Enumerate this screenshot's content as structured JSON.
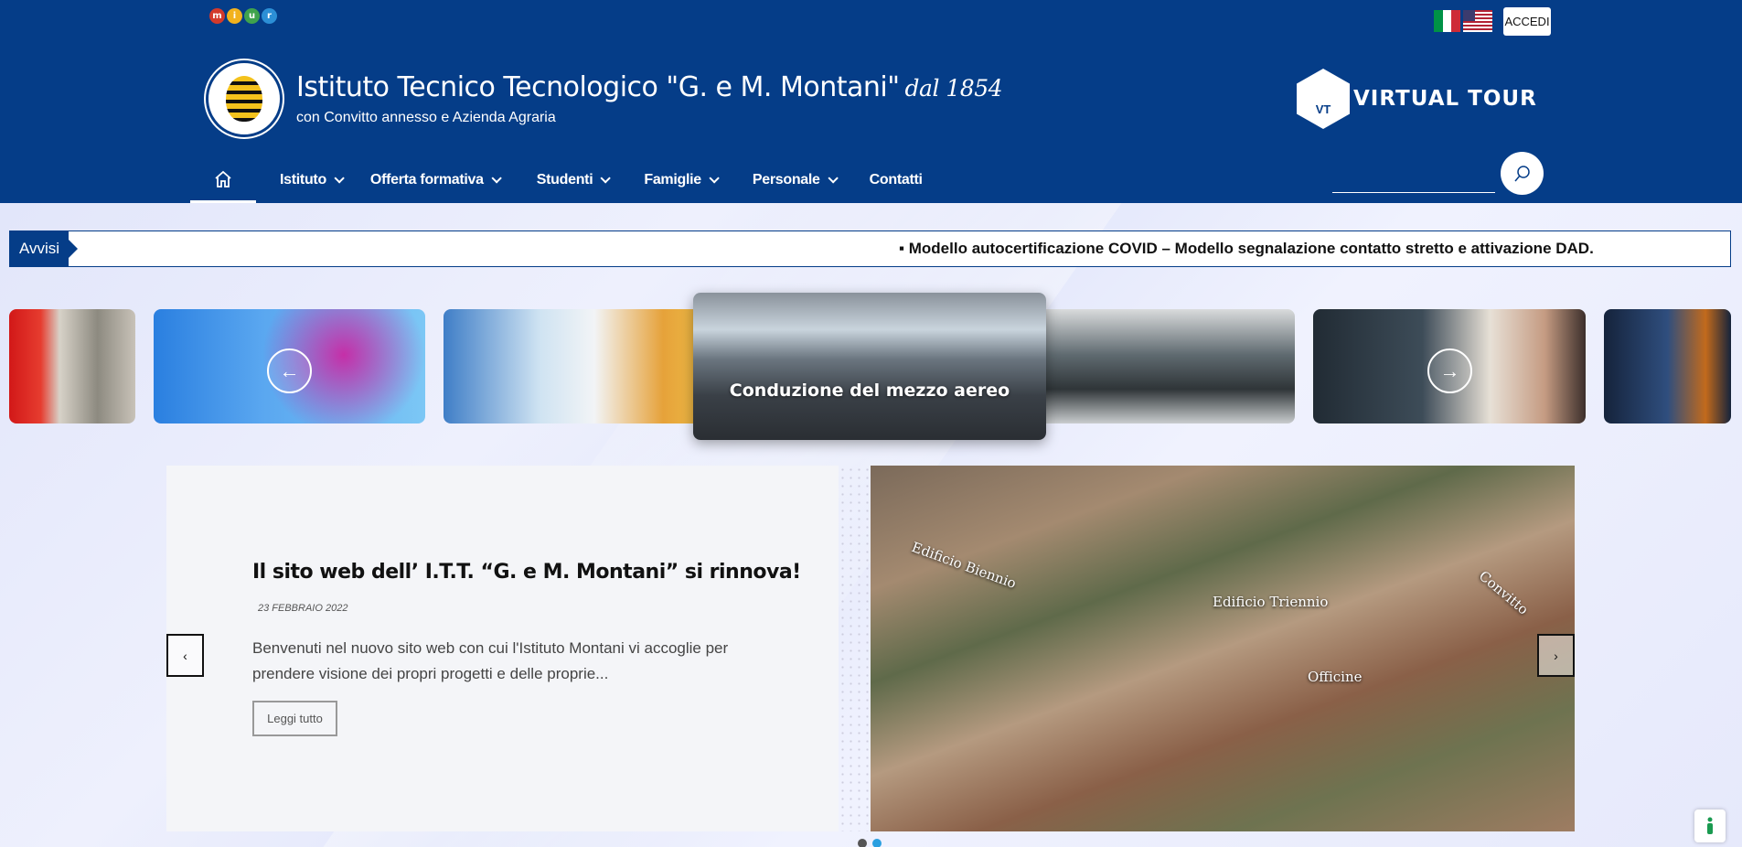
{
  "top_bar": {
    "miur_letters": [
      "m",
      "i",
      "u",
      "r"
    ],
    "miur_colors": [
      "#d33a2c",
      "#f2b21d",
      "#3fa34d",
      "#2c8fd6"
    ],
    "login_label": "ACCEDI"
  },
  "branding": {
    "title": "Istituto Tecnico Tecnologico \"G. e M. Montani\"",
    "since": "dal 1854",
    "subtitle": "con Convitto annesso e Azienda Agraria",
    "virtual_tour_badge": "VT",
    "virtual_tour_label": "VIRTUAL TOUR"
  },
  "nav": {
    "items": [
      {
        "label": "Istituto",
        "dropdown": true
      },
      {
        "label": "Offerta formativa",
        "dropdown": true
      },
      {
        "label": "Studenti",
        "dropdown": true
      },
      {
        "label": "Famiglie",
        "dropdown": true
      },
      {
        "label": "Personale",
        "dropdown": true
      },
      {
        "label": "Contatti",
        "dropdown": false
      }
    ]
  },
  "avvisi": {
    "label": "Avvisi",
    "ticker": "▪ Modello autocertificazione COVID – Modello segnalazione contatto stretto e attivazione DAD."
  },
  "carousel": {
    "active_caption": "Conduzione del mezzo aereo",
    "prev_icon": "←",
    "next_icon": "→"
  },
  "news": {
    "title": "Il sito web dell’ I.T.T. “G. e M. Montani” si rinnova!",
    "date": "23 FEBBRAIO 2022",
    "excerpt": "Benvenuti nel nuovo sito web con cui l'Istituto Montani vi accoglie per prendere visione dei propri progetti e delle proprie...",
    "read_more": "Leggi tutto",
    "photo_labels": [
      "Edificio Biennio",
      "Edificio Triennio",
      "Convitto",
      "Officine"
    ],
    "prev_icon": "‹",
    "next_icon": "›"
  },
  "colors": {
    "brand_blue": "#053d88",
    "pager_active": "#2a9fe0"
  }
}
